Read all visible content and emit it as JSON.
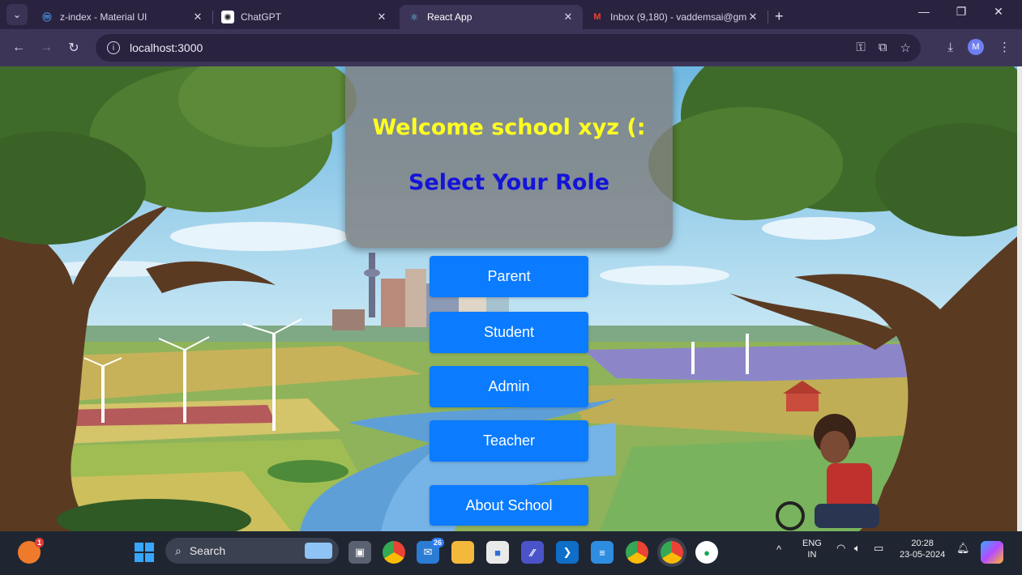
{
  "browser": {
    "tabs": [
      {
        "title": "z-index - Material UI",
        "icon": "material-ui-icon",
        "active": false
      },
      {
        "title": "ChatGPT",
        "icon": "chatgpt-icon",
        "active": false
      },
      {
        "title": "React App",
        "icon": "react-icon",
        "active": true
      },
      {
        "title": "Inbox (9,180) - vaddemsai@gm",
        "icon": "gmail-icon",
        "active": false
      }
    ],
    "address": "localhost:3000",
    "profile_initial": "M"
  },
  "page": {
    "welcome": "Welcome school xyz (:",
    "heading": "Select Your Role",
    "buttons": {
      "parent": "Parent",
      "student": "Student",
      "admin": "Admin",
      "teacher": "Teacher",
      "about": "About School"
    },
    "colors": {
      "welcome_text": "#ffff22",
      "heading_text": "#1414d8",
      "button_bg": "#0b7bff"
    }
  },
  "taskbar": {
    "search_label": "Search",
    "notification_count": "1",
    "mail_badge": "26",
    "language": "ENG",
    "region": "IN",
    "time": "20:28",
    "date": "23-05-2024"
  }
}
